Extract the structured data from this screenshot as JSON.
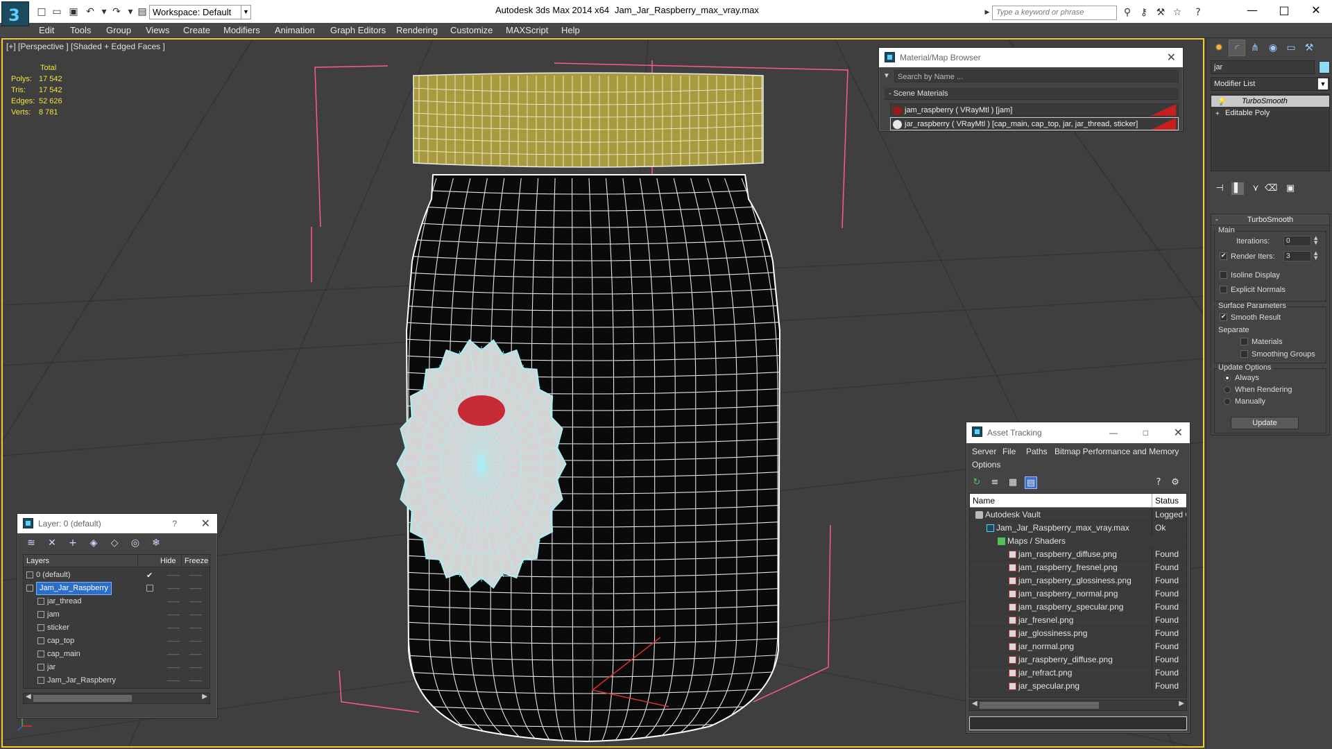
{
  "titlebar": {
    "workspace": "Workspace: Default",
    "app_title": "Autodesk 3ds Max  2014 x64",
    "file_title": "Jam_Jar_Raspberry_max_vray.max",
    "search_placeholder": "Type a keyword or phrase"
  },
  "menu": [
    "Edit",
    "Tools",
    "Group",
    "Views",
    "Create",
    "Modifiers",
    "Animation",
    "Graph Editors",
    "Rendering",
    "Customize",
    "MAXScript",
    "Help"
  ],
  "viewport": {
    "label": "[+] [Perspective ] [Shaded + Edged Faces ]",
    "stats": {
      "total": "Total",
      "rows": [
        {
          "label": "Polys:",
          "value": "17 542"
        },
        {
          "label": "Tris:",
          "value": "17 542"
        },
        {
          "label": "Edges:",
          "value": "52 626"
        },
        {
          "label": "Verts:",
          "value": "8 781"
        }
      ]
    }
  },
  "material_browser": {
    "title": "Material/Map Browser",
    "search_placeholder": "Search by Name ...",
    "section": "- Scene Materials",
    "items": [
      {
        "label": "jam_raspberry  ( VRayMtl )  [jam]",
        "swatch": "#9a1a1a"
      },
      {
        "label": "jar_raspberry  ( VRayMtl )  [cap_main, cap_top, jar, jar_thread, sticker]",
        "swatch": "#e8e8e8"
      }
    ]
  },
  "layer_window": {
    "title": "Layer: 0 (default)",
    "help": "?",
    "headers": {
      "layers": "Layers",
      "hide": "Hide",
      "freeze": "Freeze"
    },
    "rows": [
      {
        "name": "0 (default)",
        "level": 0,
        "checked": true,
        "selected": false
      },
      {
        "name": "Jam_Jar_Raspberry",
        "level": 0,
        "checked": false,
        "selected": true
      },
      {
        "name": "jar_thread",
        "level": 1,
        "checked": false,
        "selected": false
      },
      {
        "name": "jam",
        "level": 1,
        "checked": false,
        "selected": false
      },
      {
        "name": "sticker",
        "level": 1,
        "checked": false,
        "selected": false
      },
      {
        "name": "cap_top",
        "level": 1,
        "checked": false,
        "selected": false
      },
      {
        "name": "cap_main",
        "level": 1,
        "checked": false,
        "selected": false
      },
      {
        "name": "jar",
        "level": 1,
        "checked": false,
        "selected": false
      },
      {
        "name": "Jam_Jar_Raspberry",
        "level": 1,
        "checked": false,
        "selected": false
      }
    ]
  },
  "asset_tracking": {
    "title": "Asset Tracking",
    "menu": [
      "Server",
      "File",
      "Paths",
      "Bitmap Performance and Memory",
      "Options"
    ],
    "headers": {
      "name": "Name",
      "status": "Status"
    },
    "rows": [
      {
        "name": "Autodesk Vault",
        "status": "Logged Out",
        "level": 0,
        "icon": "vault"
      },
      {
        "name": "Jam_Jar_Raspberry_max_vray.max",
        "status": "Ok",
        "level": 1,
        "icon": "max"
      },
      {
        "name": "Maps / Shaders",
        "status": "",
        "level": 2,
        "icon": "folder"
      },
      {
        "name": "jam_raspberry_diffuse.png",
        "status": "Found",
        "level": 3,
        "icon": "png"
      },
      {
        "name": "jam_raspberry_fresnel.png",
        "status": "Found",
        "level": 3,
        "icon": "png"
      },
      {
        "name": "jam_raspberry_glossiness.png",
        "status": "Found",
        "level": 3,
        "icon": "png"
      },
      {
        "name": "jam_raspberry_normal.png",
        "status": "Found",
        "level": 3,
        "icon": "png"
      },
      {
        "name": "jam_raspberry_specular.png",
        "status": "Found",
        "level": 3,
        "icon": "png"
      },
      {
        "name": "jar_fresnel.png",
        "status": "Found",
        "level": 3,
        "icon": "png"
      },
      {
        "name": "jar_glossiness.png",
        "status": "Found",
        "level": 3,
        "icon": "png"
      },
      {
        "name": "jar_normal.png",
        "status": "Found",
        "level": 3,
        "icon": "png"
      },
      {
        "name": "jar_raspberry_diffuse.png",
        "status": "Found",
        "level": 3,
        "icon": "png"
      },
      {
        "name": "jar_refract.png",
        "status": "Found",
        "level": 3,
        "icon": "png"
      },
      {
        "name": "jar_specular.png",
        "status": "Found",
        "level": 3,
        "icon": "png"
      }
    ]
  },
  "command_panel": {
    "object_name": "jar",
    "object_color": "#8edbf2",
    "modifier_list": "Modifier List",
    "stack": [
      "TurboSmooth",
      "Editable Poly"
    ],
    "rollout": {
      "title": "TurboSmooth",
      "main": "Main",
      "iterations_label": "Iterations:",
      "iterations": "0",
      "render_iters_label": "Render Iters:",
      "render_iters": "3",
      "render_iters_checked": true,
      "isoline": "Isoline Display",
      "explicit_normals": "Explicit Normals",
      "surface_params": "Surface Parameters",
      "smooth_result": "Smooth Result",
      "separate": "Separate",
      "materials": "Materials",
      "smoothing_groups": "Smoothing Groups",
      "update_options": "Update Options",
      "always": "Always",
      "when_rendering": "When Rendering",
      "manually": "Manually",
      "update": "Update"
    }
  },
  "colors": {
    "viewport_border": "#f4cc2b",
    "wire": "#ffffff",
    "selection_wire": "#a8f0f8",
    "cap_color": "#a89a3e",
    "selection_bracket": "#ff5a8a"
  }
}
